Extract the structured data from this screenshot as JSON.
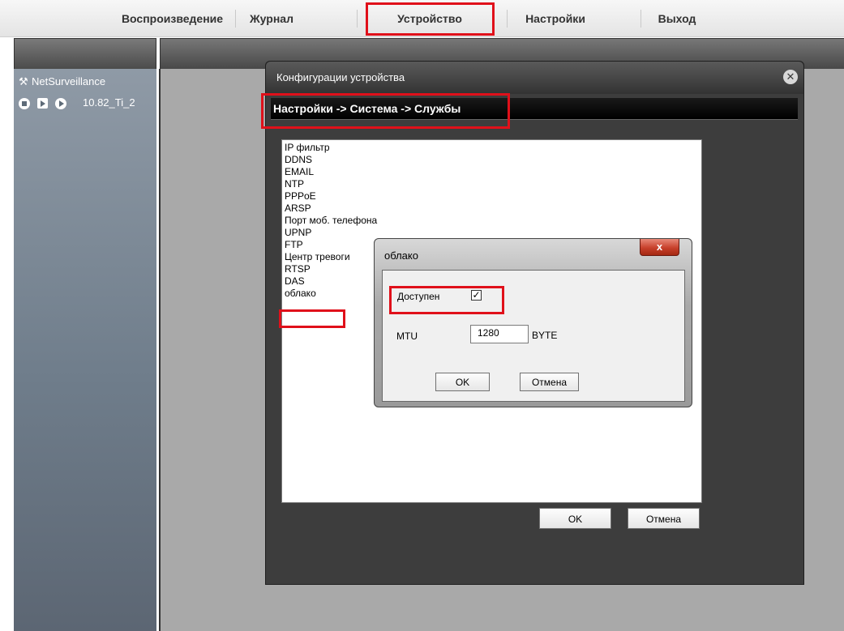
{
  "menu": {
    "items": [
      {
        "label": "Воспроизведение"
      },
      {
        "label": "Журнал"
      },
      {
        "label": "Устройство"
      },
      {
        "label": "Настройки"
      },
      {
        "label": "Выход"
      }
    ]
  },
  "sidebar": {
    "title": "NetSurveillance",
    "channel": "10.82_Ti_2"
  },
  "config_dialog": {
    "title": "Конфигурации устройства",
    "breadcrumb": "Настройки -> Система -> Службы",
    "services": [
      "IP фильтр",
      "DDNS",
      "EMAIL",
      "NTP",
      "PPPoE",
      "ARSP",
      "Порт моб. телефона",
      "UPNP",
      "FTP",
      "Центр тревоги",
      "RTSP",
      "DAS",
      "облако"
    ],
    "ok_label": "OK",
    "cancel_label": "Отмена"
  },
  "cloud_dialog": {
    "title": "облако",
    "close_glyph": "x",
    "enabled_label": "Доступен",
    "enabled_check": "✓",
    "mtu_label": "MTU",
    "mtu_value": "1280",
    "mtu_unit": "BYTE",
    "ok_label": "OK",
    "cancel_label": "Отмена"
  },
  "colors": {
    "highlight": "#e0101a",
    "dialog_bg": "#3d3d3d"
  }
}
